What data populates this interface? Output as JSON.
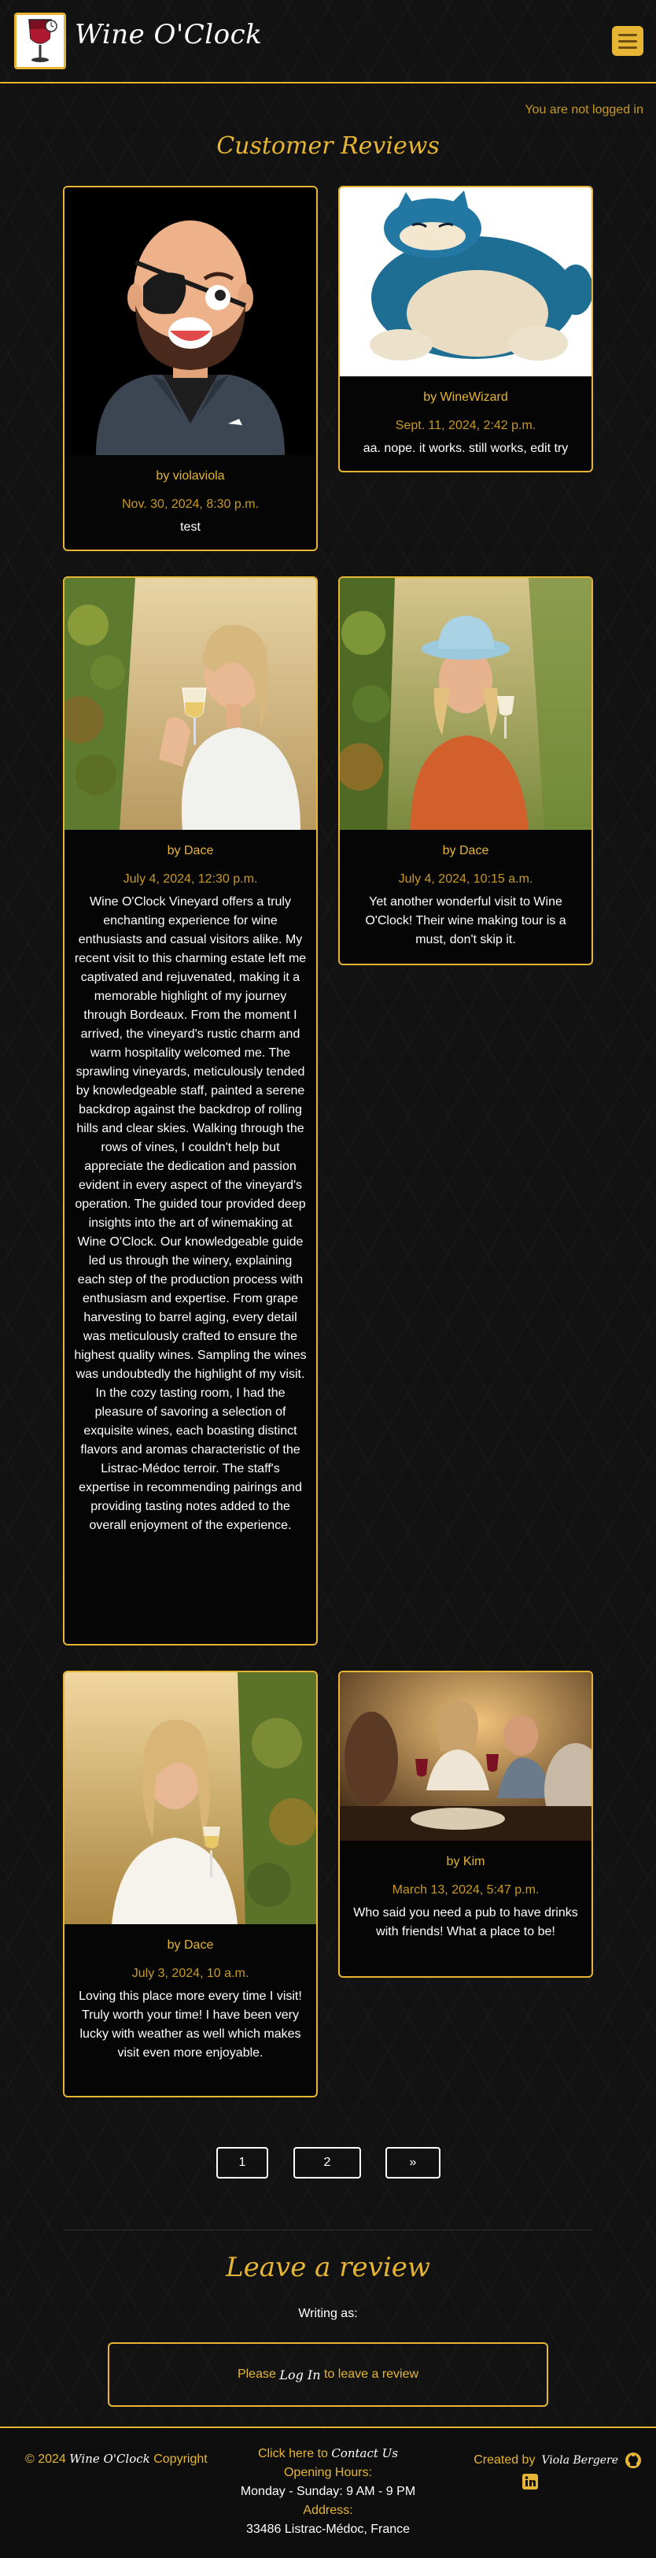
{
  "header": {
    "brand": "Wine O'Clock",
    "login_status": "You are not logged in"
  },
  "page_title": "Customer Reviews",
  "reviews": [
    {
      "author": "by violaviola",
      "date": "Nov. 30, 2024, 8:30 p.m.",
      "text": "test"
    },
    {
      "author": "by WineWizard",
      "date": "Sept. 11, 2024, 2:42 p.m.",
      "text": "aa. nope. it works. still works, edit try"
    },
    {
      "author": "by Dace",
      "date": "July 4, 2024, 12:30 p.m.",
      "text": "Wine O'Clock Vineyard offers a truly enchanting experience for wine enthusiasts and casual visitors alike. My recent visit to this charming estate left me captivated and rejuvenated, making it a memorable highlight of my journey through Bordeaux. From the moment I arrived, the vineyard's rustic charm and warm hospitality welcomed me. The sprawling vineyards, meticulously tended by knowledgeable staff, painted a serene backdrop against the backdrop of rolling hills and clear skies. Walking through the rows of vines, I couldn't help but appreciate the dedication and passion evident in every aspect of the vineyard's operation. The guided tour provided deep insights into the art of winemaking at Wine O'Clock. Our knowledgeable guide led us through the winery, explaining each step of the production process with enthusiasm and expertise. From grape harvesting to barrel aging, every detail was meticulously crafted to ensure the highest quality wines. Sampling the wines was undoubtedly the highlight of my visit. In the cozy tasting room, I had the pleasure of savoring a selection of exquisite wines, each boasting distinct flavors and aromas characteristic of the Listrac-Médoc terroir. The staff's expertise in recommending pairings and providing tasting notes added to the overall enjoyment of the experience."
    },
    {
      "author": "by Dace",
      "date": "July 4, 2024, 10:15 a.m.",
      "text": "Yet another wonderful visit to Wine O'Clock! Their wine making tour is a must, don't skip it."
    },
    {
      "author": "by Dace",
      "date": "July 3, 2024, 10 a.m.",
      "text": "Loving this place more every time I visit! Truly worth your time! I have been very lucky with weather as well which makes visit even more enjoyable."
    },
    {
      "author": "by Kim",
      "date": "March 13, 2024, 5:47 p.m.",
      "text": "Who said you need a pub to have drinks with friends! What a place to be!"
    }
  ],
  "pagination": {
    "page1": "1",
    "page2": "2",
    "next": "»"
  },
  "leave_review": {
    "title": "Leave a review",
    "writing_as": "Writing as:",
    "prompt_before": "Please",
    "login_link": "Log In",
    "prompt_after": "to leave a review"
  },
  "footer": {
    "copyright_prefix": "© 2024",
    "copyright_brand": "Wine O'Clock",
    "copyright_suffix": "Copyright",
    "contact_prefix": "Click here to",
    "contact_link": "Contact Us",
    "hours_label": "Opening Hours:",
    "hours_value": "Monday - Sunday: 9 AM - 9 PM",
    "address_label": "Address:",
    "address_value": "33486 Listrac-Médoc, France",
    "created_prefix": "Created by",
    "created_name": "Viola Bergere"
  },
  "colors": {
    "accent": "#e6b533",
    "background": "#121212"
  },
  "icons": [
    "menu-icon",
    "github-icon",
    "linkedin-icon",
    "wine-glass-logo"
  ]
}
